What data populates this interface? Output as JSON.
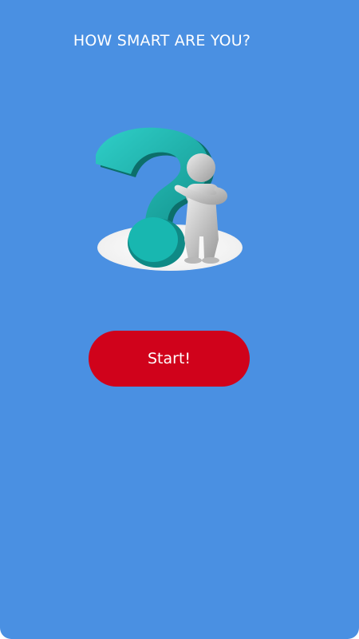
{
  "screen": {
    "title": "HOW SMART ARE YOU?",
    "hero_icon": "question-mark-thinking-person-icon",
    "start_label": "Start!"
  },
  "colors": {
    "background": "#4a90e2",
    "button": "#d0021b",
    "text": "#ffffff",
    "question_mark": "#19b3ad"
  }
}
